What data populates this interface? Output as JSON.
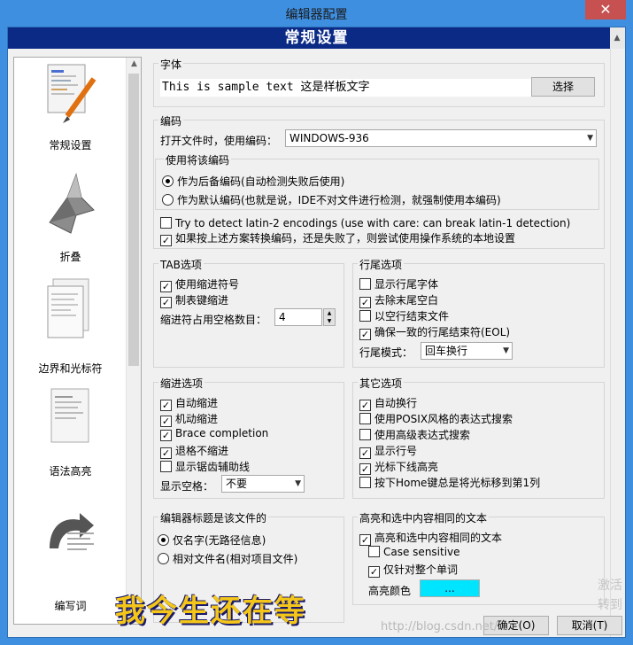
{
  "window": {
    "title": "编辑器配置",
    "close_glyph": "✕"
  },
  "header": {
    "title": "常规设置"
  },
  "sidebar": {
    "items": [
      {
        "label": "常规设置",
        "icon": "general-settings-icon"
      },
      {
        "label": "折叠",
        "icon": "folding-icon"
      },
      {
        "label": "边界和光标符",
        "icon": "margins-caret-icon"
      },
      {
        "label": "语法高亮",
        "icon": "syntax-highlight-icon"
      },
      {
        "label": "编写词",
        "icon": "code-completion-icon"
      }
    ]
  },
  "font": {
    "group_title": "字体",
    "sample": "This is sample text 这是样板文字",
    "choose_button": "选择"
  },
  "encoding": {
    "group_title": "编码",
    "open_label": "打开文件时，使用编码：",
    "open_value": "WINDOWS-936",
    "use_group_title": "使用将该编码",
    "radio_fallback": "作为后备编码(自动检测失败后使用)",
    "radio_default": "作为默认编码(也就是说，IDE不对文件进行检测，就强制使用本编码)",
    "latin2": "Try to detect latin-2 encodings (use with care: can break latin-1 detection)",
    "fallback_system": "如果按上述方案转换编码，还是失败了，则尝试使用操作系统的本地设置"
  },
  "tab": {
    "group_title": "TAB选项",
    "use_indent": "使用缩进符号",
    "tab_indent": "制表键缩进",
    "spaces_label": "缩进符占用空格数目：",
    "spaces_value": "4"
  },
  "eol": {
    "group_title": "行尾选项",
    "show_eol": "显示行尾字体",
    "strip_trailing": "去除末尾空白",
    "end_blank": "以空行结束文件",
    "ensure_eol": "确保一致的行尾结束符(EOL)",
    "mode_label": "行尾模式：",
    "mode_value": "回车换行"
  },
  "indent": {
    "group_title": "缩进选项",
    "auto_indent": "自动缩进",
    "smart_indent": "机动缩进",
    "brace": "Brace completion",
    "backspace_unindent": "退格不缩进",
    "show_guides": "显示锯齿辅助线",
    "show_space_label": "显示空格：",
    "show_space_value": "不要"
  },
  "other": {
    "group_title": "其它选项",
    "wrap": "自动换行",
    "posix": "使用POSIX风格的表达式搜索",
    "advanced": "使用高级表达式搜索",
    "line_numbers": "显示行号",
    "caret_line": "光标下线高亮",
    "home_key": "按下Home键总是将光标移到第1列"
  },
  "title_option": {
    "group_title": "编辑器标题是该文件的",
    "name_only": "仅名字(无路径信息)",
    "relative": "相对文件名(相对项目文件)"
  },
  "highlight": {
    "group_title": "高亮和选中内容相同的文本",
    "enable": "高亮和选中内容相同的文本",
    "case": "Case sensitive",
    "whole_word": "仅针对整个单词",
    "color_label": "高亮颜色",
    "color_button": "...",
    "color": "#00e5ff"
  },
  "buttons": {
    "ok": "确定(O)",
    "cancel": "取消(T)"
  },
  "overlay": {
    "caption": "我今生还在等",
    "url": "http://blog.csdn.net/..."
  },
  "activation": {
    "line1": "激活",
    "line2": "转到"
  }
}
